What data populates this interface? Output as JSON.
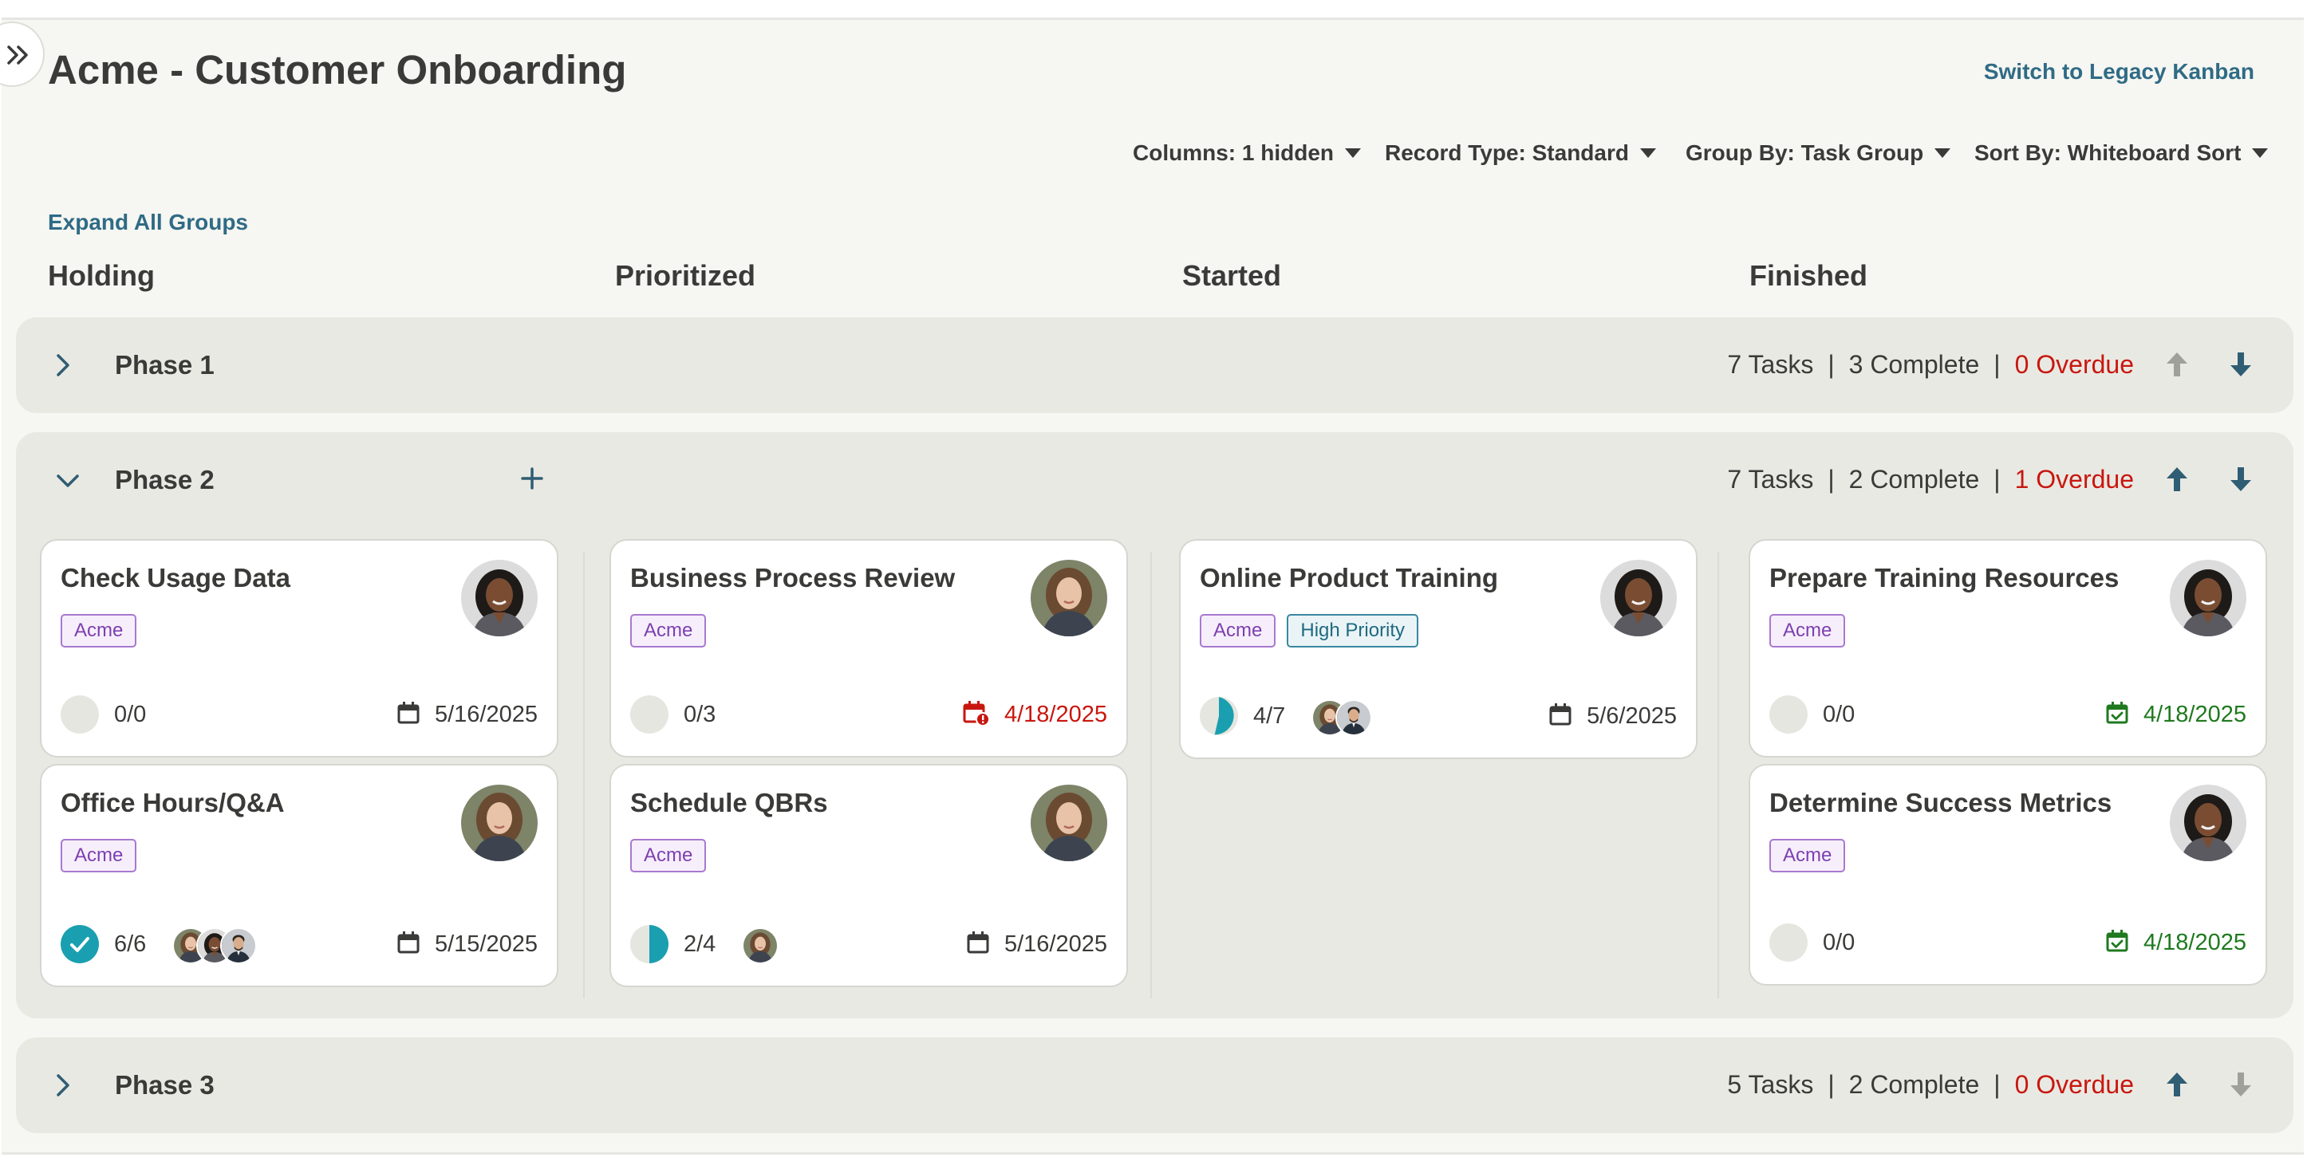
{
  "header": {
    "title": "Acme - Customer Onboarding",
    "legacy_link": "Switch to Legacy Kanban"
  },
  "filters": {
    "columns": "Columns: 1 hidden",
    "record_type": "Record Type: Standard",
    "group_by": "Group By: Task Group",
    "sort_by": "Sort By: Whiteboard Sort"
  },
  "expand_all": "Expand All Groups",
  "columns": [
    "Holding",
    "Prioritized",
    "Started",
    "Finished"
  ],
  "colors": {
    "link": "#2f6b85",
    "overdue_red": "#c8170f",
    "done_green": "#1f7a1f",
    "progress_teal": "#1a9fb0",
    "tag_purple": "#7d3fb0",
    "tag_teal": "#1f6a80"
  },
  "phases": [
    {
      "name": "Phase 1",
      "expanded": false,
      "tasks": "7 Tasks",
      "complete": "3 Complete",
      "overdue": "0 Overdue",
      "up_enabled": false,
      "down_enabled": true
    },
    {
      "name": "Phase 2",
      "expanded": true,
      "tasks": "7 Tasks",
      "complete": "2 Complete",
      "overdue": "1 Overdue",
      "up_enabled": true,
      "down_enabled": true
    },
    {
      "name": "Phase 3",
      "expanded": false,
      "tasks": "5 Tasks",
      "complete": "2 Complete",
      "overdue": "0 Overdue",
      "up_enabled": true,
      "down_enabled": false
    }
  ],
  "cards": {
    "check_usage": {
      "title": "Check Usage Data",
      "tags": [
        "Acme"
      ],
      "progress": "0/0",
      "progress_fraction": 0,
      "due": "5/16/2025",
      "due_status": "normal",
      "owner_icon": "avatar-woman-dark-hair"
    },
    "office_hours": {
      "title": "Office Hours/Q&A",
      "tags": [
        "Acme"
      ],
      "progress": "6/6",
      "progress_fraction": 1,
      "due": "5/15/2025",
      "due_status": "normal",
      "owner_icon": "avatar-woman-brown-hair"
    },
    "business_process": {
      "title": "Business Process Review",
      "tags": [
        "Acme"
      ],
      "progress": "0/3",
      "progress_fraction": 0,
      "due": "4/18/2025",
      "due_status": "overdue",
      "owner_icon": "avatar-woman-brown-hair"
    },
    "schedule_qbrs": {
      "title": "Schedule QBRs",
      "tags": [
        "Acme"
      ],
      "progress": "2/4",
      "progress_fraction": 0.5,
      "due": "5/16/2025",
      "due_status": "normal",
      "owner_icon": "avatar-woman-brown-hair"
    },
    "online_training": {
      "title": "Online Product Training",
      "tags": [
        "Acme",
        "High Priority"
      ],
      "progress": "4/7",
      "progress_fraction": 0.571,
      "due": "5/6/2025",
      "due_status": "normal",
      "owner_icon": "avatar-woman-dark-hair"
    },
    "prepare_training": {
      "title": "Prepare Training Resources",
      "tags": [
        "Acme"
      ],
      "progress": "0/0",
      "progress_fraction": 0,
      "due": "4/18/2025",
      "due_status": "done",
      "owner_icon": "avatar-woman-dark-hair"
    },
    "success_metrics": {
      "title": "Determine Success Metrics",
      "tags": [
        "Acme"
      ],
      "progress": "0/0",
      "progress_fraction": 0,
      "due": "4/18/2025",
      "due_status": "done",
      "owner_icon": "avatar-woman-dark-hair"
    }
  }
}
